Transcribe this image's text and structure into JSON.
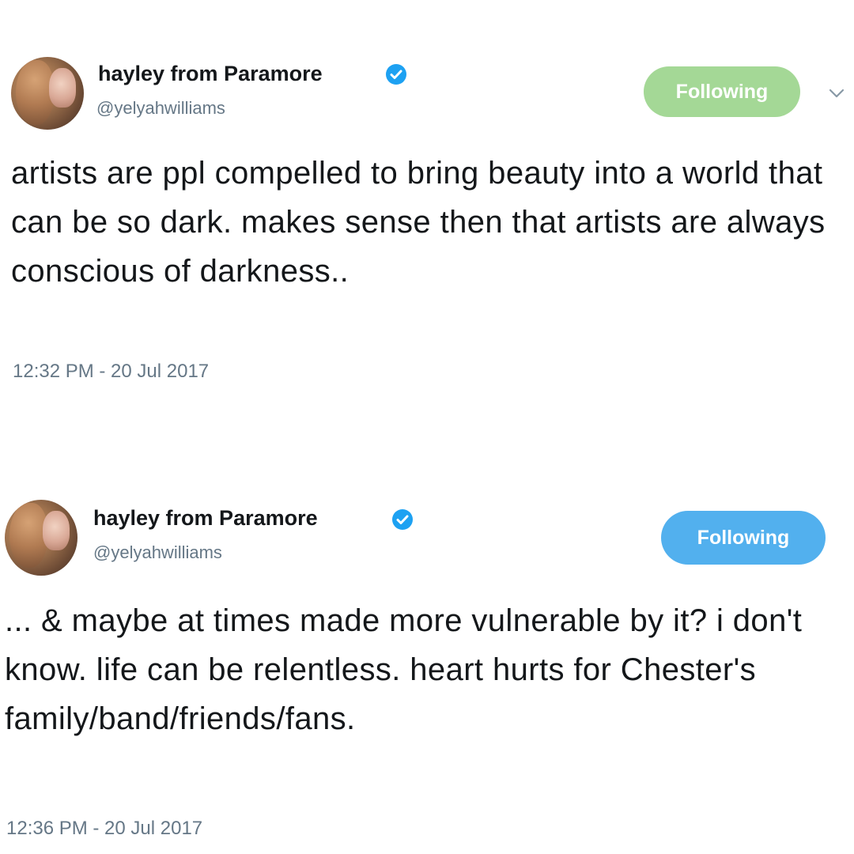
{
  "tweets": [
    {
      "display_name": "hayley from Paramore",
      "handle": "@yelyahwilliams",
      "follow_label": "Following",
      "text": "artists are ppl compelled to bring beauty into a world that can be so dark. makes sense then that artists are always conscious of darkness..",
      "timestamp": "12:32 PM - 20 Jul 2017",
      "verified_icon": "verified-badge",
      "button_color": "#a4d896"
    },
    {
      "display_name": "hayley from Paramore",
      "handle": "@yelyahwilliams",
      "follow_label": "Following",
      "text": "... & maybe at times made more vulnerable by it? i don't know. life can be relentless. heart hurts for Chester's family/band/friends/fans.",
      "timestamp": "12:36 PM - 20 Jul 2017",
      "verified_icon": "verified-badge",
      "button_color": "#52b0ee"
    }
  ],
  "colors": {
    "verified_blue": "#1da1f2",
    "text_primary": "#14171a",
    "text_secondary": "#657786"
  }
}
